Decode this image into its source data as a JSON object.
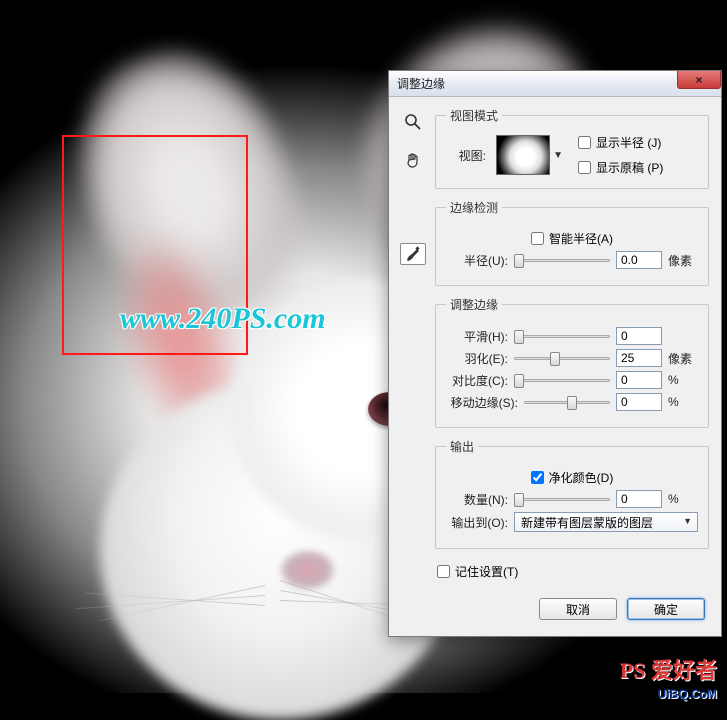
{
  "dialog": {
    "title": "调整边缘",
    "close_label": "×",
    "tools": {
      "zoom": "zoom-tool",
      "hand": "hand-tool",
      "brush": "refine-brush-tool"
    },
    "view_mode": {
      "legend": "视图模式",
      "view_label": "视图:",
      "show_radius": "显示半径 (J)",
      "show_original": "显示原稿 (P)",
      "show_radius_checked": false,
      "show_original_checked": false
    },
    "edge_detection": {
      "legend": "边缘检测",
      "smart_radius": "智能半径(A)",
      "smart_radius_checked": false,
      "radius_label": "半径(U):",
      "radius_value": "0.0",
      "radius_unit": "像素",
      "radius_thumb_pct": 0
    },
    "adjust_edge": {
      "legend": "调整边缘",
      "smooth_label": "平滑(H):",
      "smooth_value": "0",
      "smooth_thumb_pct": 0,
      "feather_label": "羽化(E):",
      "feather_value": "25",
      "feather_unit": "像素",
      "feather_thumb_pct": 38,
      "contrast_label": "对比度(C):",
      "contrast_value": "0",
      "contrast_unit": "%",
      "contrast_thumb_pct": 0,
      "shift_label": "移动边缘(S):",
      "shift_value": "0",
      "shift_unit": "%",
      "shift_thumb_pct": 50
    },
    "output": {
      "legend": "输出",
      "decontaminate": "净化颜色(D)",
      "decontaminate_checked": true,
      "amount_label": "数量(N):",
      "amount_value": "0",
      "amount_unit": "%",
      "amount_thumb_pct": 0,
      "output_to_label": "输出到(O):",
      "output_to_value": "新建带有图层蒙版的图层"
    },
    "remember": "记住设置(T)",
    "remember_checked": false,
    "buttons": {
      "cancel": "取消",
      "ok": "确定"
    }
  },
  "watermark": {
    "url": "www.240PS.com",
    "tag1": "PS 爱好者",
    "tag2": "UiBQ.CoM"
  }
}
